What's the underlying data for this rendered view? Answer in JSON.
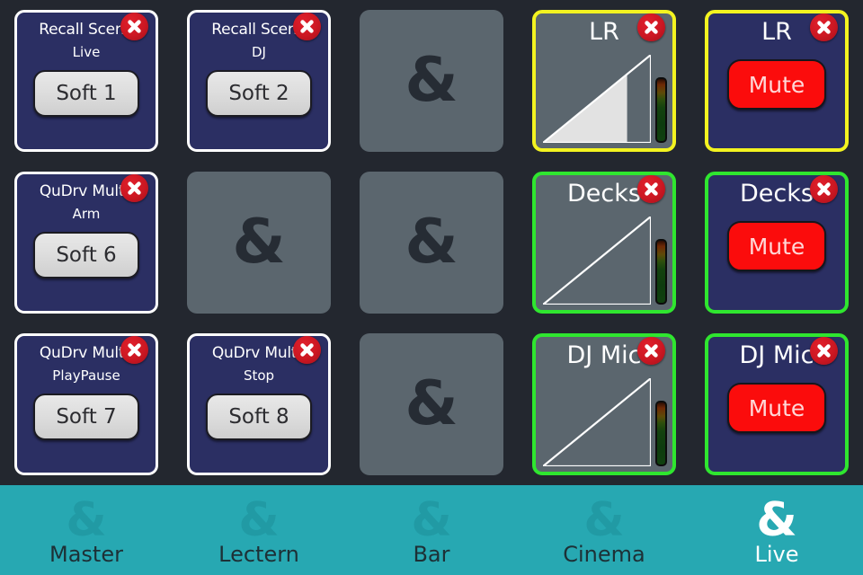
{
  "colors": {
    "background": "#23272f",
    "soft_cell": "#2b2f63",
    "empty_cell": "#5b666e",
    "fader_cell": "#5b666e",
    "accent_yellow": "#f3f320",
    "accent_green": "#2fe62f",
    "mute_red": "#fb0c0c",
    "navbar_teal": "#27a8b2",
    "navbar_inactive_icon": "#219aa4",
    "navbar_inactive_label": "#1d3036",
    "navbar_active": "#ffffff"
  },
  "grid": {
    "columns": 5,
    "rows": 3,
    "cells": [
      {
        "type": "softkey",
        "title": "Recall Scene",
        "subtitle": "Live",
        "button_label": "Soft 1",
        "closable": true,
        "accent": "none"
      },
      {
        "type": "softkey",
        "title": "Recall Scene",
        "subtitle": "DJ",
        "button_label": "Soft 2",
        "closable": true,
        "accent": "none"
      },
      {
        "type": "empty",
        "glyph": "&",
        "closable": false,
        "accent": "none"
      },
      {
        "type": "fader",
        "title": "LR",
        "level_percent": 78,
        "closable": true,
        "accent": "yellow"
      },
      {
        "type": "mute",
        "title": "LR",
        "button_label": "Mute",
        "closable": true,
        "accent": "yellow"
      },
      {
        "type": "softkey",
        "title": "QuDrv Multi.",
        "subtitle": "Arm",
        "button_label": "Soft 6",
        "closable": true,
        "accent": "none"
      },
      {
        "type": "empty",
        "glyph": "&",
        "closable": false,
        "accent": "none"
      },
      {
        "type": "empty",
        "glyph": "&",
        "closable": false,
        "accent": "none"
      },
      {
        "type": "fader",
        "title": "Decks",
        "level_percent": 0,
        "closable": true,
        "accent": "green"
      },
      {
        "type": "mute",
        "title": "Decks",
        "button_label": "Mute",
        "closable": true,
        "accent": "green"
      },
      {
        "type": "softkey",
        "title": "QuDrv Multi.",
        "subtitle": "PlayPause",
        "button_label": "Soft 7",
        "closable": true,
        "accent": "none"
      },
      {
        "type": "softkey",
        "title": "QuDrv Multi.",
        "subtitle": "Stop",
        "button_label": "Soft 8",
        "closable": true,
        "accent": "none"
      },
      {
        "type": "empty",
        "glyph": "&",
        "closable": false,
        "accent": "none"
      },
      {
        "type": "fader",
        "title": "DJ Mic",
        "level_percent": 0,
        "closable": true,
        "accent": "green"
      },
      {
        "type": "mute",
        "title": "DJ Mic",
        "button_label": "Mute",
        "closable": true,
        "accent": "green"
      }
    ]
  },
  "navbar": {
    "items": [
      {
        "label": "Master",
        "glyph": "&",
        "active": false
      },
      {
        "label": "Lectern",
        "glyph": "&",
        "active": false
      },
      {
        "label": "Bar",
        "glyph": "&",
        "active": false
      },
      {
        "label": "Cinema",
        "glyph": "&",
        "active": false
      },
      {
        "label": "Live",
        "glyph": "&",
        "active": true
      }
    ]
  }
}
